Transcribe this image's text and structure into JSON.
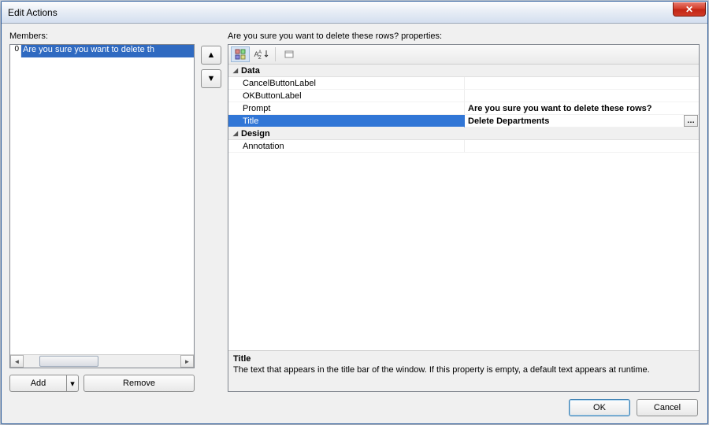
{
  "window": {
    "title": "Edit Actions"
  },
  "left": {
    "label": "Members:",
    "items": [
      {
        "index": "0",
        "text": "Are you sure you want to delete th"
      }
    ],
    "add_label": "Add",
    "remove_label": "Remove"
  },
  "right": {
    "header": "Are you sure you want to delete these rows? properties:",
    "categories": [
      {
        "name": "Data",
        "props": [
          {
            "name": "CancelButtonLabel",
            "value": ""
          },
          {
            "name": "OKButtonLabel",
            "value": ""
          },
          {
            "name": "Prompt",
            "value": "Are you sure you want to delete these rows?",
            "bold": true
          },
          {
            "name": "Title",
            "value": "Delete Departments",
            "selected": true,
            "ellipsis": true
          }
        ]
      },
      {
        "name": "Design",
        "props": [
          {
            "name": "Annotation",
            "value": ""
          }
        ]
      }
    ],
    "description": {
      "title": "Title",
      "text": "The text that appears in the title bar of the window. If this property is empty, a default text appears at runtime."
    }
  },
  "footer": {
    "ok": "OK",
    "cancel": "Cancel"
  },
  "icons": {
    "close": "✕",
    "up": "▲",
    "down": "▼",
    "left": "◄",
    "right": "►",
    "dropdown": "▾",
    "expand": "◢",
    "categorized": "⊞",
    "alpha": "A̲Z↓",
    "pages": "▭"
  }
}
